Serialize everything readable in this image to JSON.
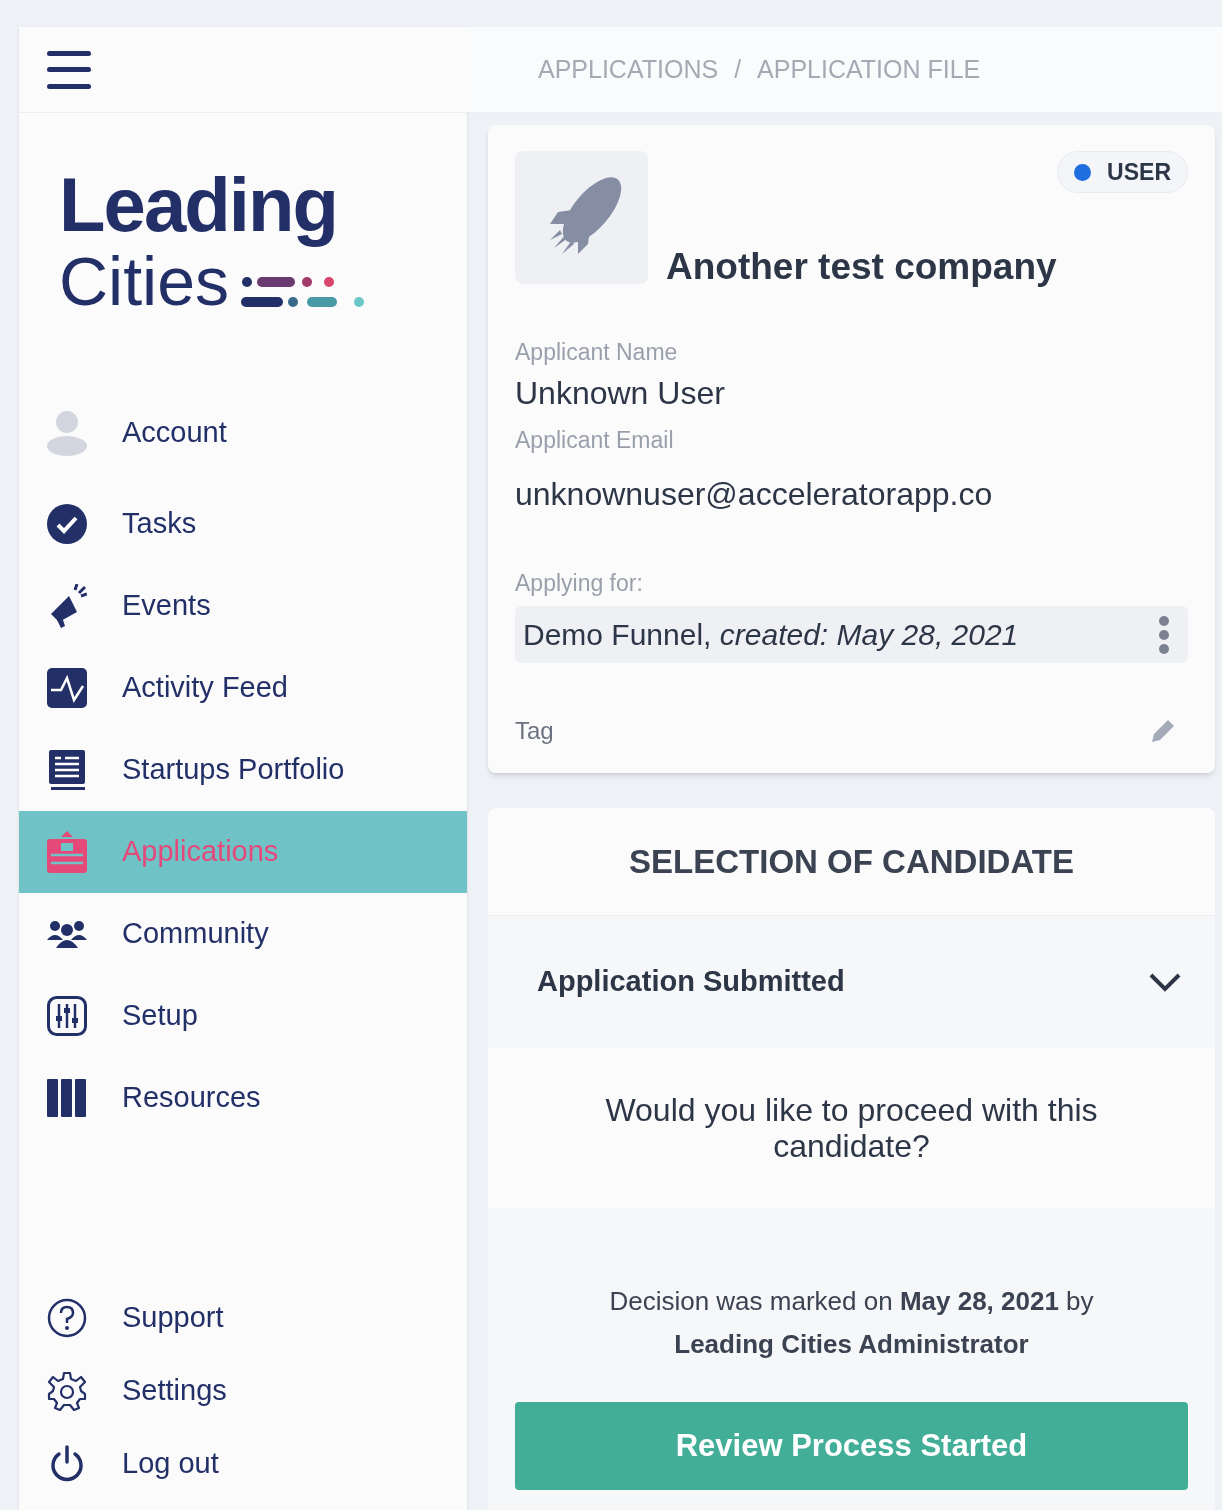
{
  "breadcrumb": [
    "APPLICATIONS",
    "/",
    "APPLICATION FILE"
  ],
  "logo": {
    "line_1": "Leading",
    "line_2": "Cities"
  },
  "nav": [
    {
      "label": "Account",
      "selected": false
    },
    {
      "label": "Tasks",
      "selected": false
    },
    {
      "label": "Events",
      "selected": false
    },
    {
      "label": "Activity Feed",
      "selected": false
    },
    {
      "label": "Startups Portfolio",
      "selected": false
    },
    {
      "label": "Applications",
      "selected": true
    },
    {
      "label": "Community",
      "selected": false
    },
    {
      "label": "Setup",
      "selected": false
    },
    {
      "label": "Resources",
      "selected": false
    }
  ],
  "footer_nav": [
    {
      "label": "Support"
    },
    {
      "label": "Settings"
    },
    {
      "label": "Log out"
    }
  ],
  "company": {
    "name": "Another test company",
    "badge": "USER",
    "fields": [
      {
        "label": "Applicant Name",
        "value": "Unknown User"
      },
      {
        "label": "Applicant Email",
        "value": "unknownuser@acceleratorapp.co"
      }
    ],
    "applying_label": "Applying for:",
    "applying_value": "Demo Funnel, *created: May 28, 2021*",
    "tag_label": "Tag"
  },
  "selection": {
    "title": "SELECTION OF CANDIDATE",
    "stage": "Application Submitted",
    "expanded": true,
    "question": "Would you like to proceed with this candidate?",
    "decision": "Decision was marked on **May 28, 2021** by **Leading Cities Administrator**",
    "button": "Review Process Started"
  }
}
